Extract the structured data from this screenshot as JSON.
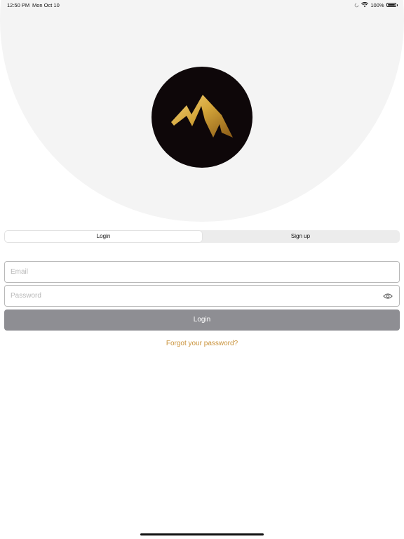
{
  "status_bar": {
    "time": "12:50 PM",
    "date": "Mon Oct 10",
    "battery": "100%",
    "icons": [
      "sync-icon",
      "wifi-icon",
      "battery-icon"
    ]
  },
  "logo": {
    "icon": "mountain-peak-logo-icon",
    "background_color": "#0e0709",
    "accent_color": "#d4a63a"
  },
  "tabs": [
    {
      "label": "Login",
      "selected": true
    },
    {
      "label": "Sign up",
      "selected": false
    }
  ],
  "form": {
    "email": {
      "placeholder": "Email",
      "value": ""
    },
    "password": {
      "placeholder": "Password",
      "value": "",
      "toggle_icon": "eye-icon"
    },
    "submit_label": "Login",
    "submit_color": "#8e8e93"
  },
  "forgot_password": {
    "label": "Forgot your password?",
    "color": "#c9923a"
  }
}
